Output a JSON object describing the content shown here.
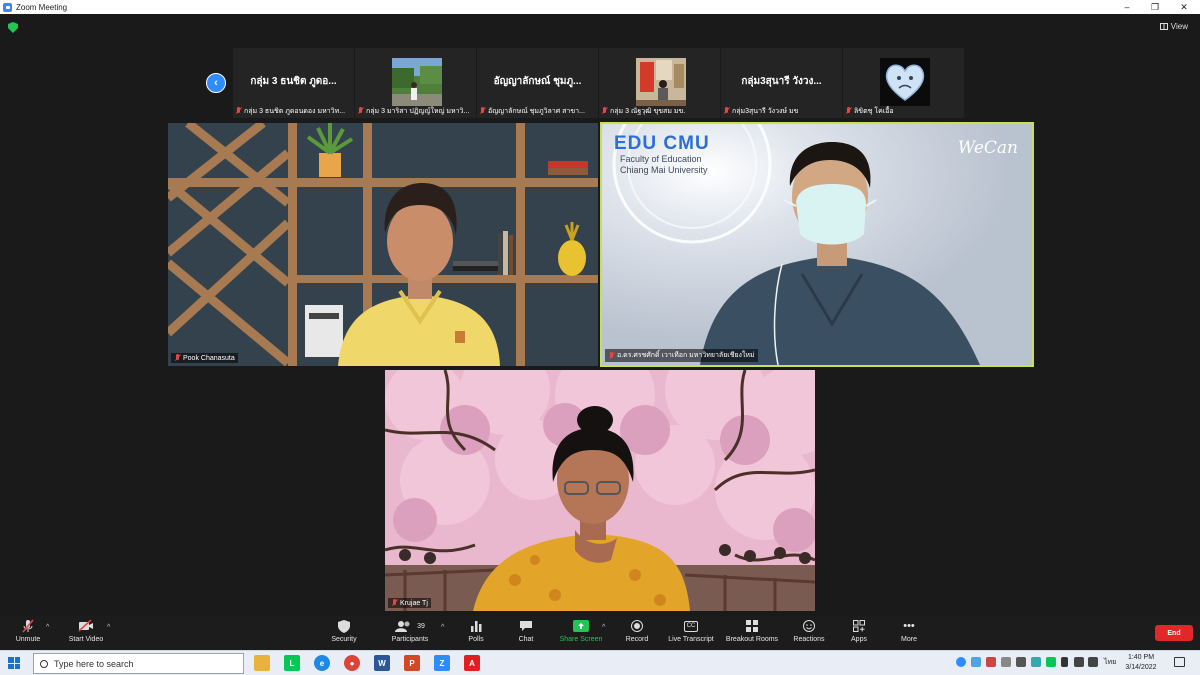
{
  "window": {
    "title": "Zoom Meeting",
    "controls": [
      "–",
      "❐",
      "✕"
    ]
  },
  "meeting": {
    "view_label": "View",
    "thumbnail_strip": [
      {
        "display_name": "กลุ่ม 3 ธนชิต ภูดอ...",
        "footer": "กลุ่ม 3 ธนชิต ภูดอนดอง มหาวิท...",
        "has_video": false
      },
      {
        "display_name": "",
        "footer": "กลุ่ม 3 มาริสา ปฏิญญ์ใหญ่ มหาวิ...",
        "has_video": true
      },
      {
        "display_name": "อัญญาลักษณ์ ชุมภู...",
        "footer": "อัญญาลักษณ์ ชุมภูวิลาศ สาขา...",
        "has_video": false
      },
      {
        "display_name": "",
        "footer": "กลุ่ม 3 ณัฐวุฒิ ขุขสม มข.",
        "has_video": true
      },
      {
        "display_name": "กลุ่ม3สุนารี วังวง...",
        "footer": "กลุ่ม3สุนารี วังวงษ์ มข",
        "has_video": false
      },
      {
        "display_name": "",
        "footer": "ลิขิตชุ โคเอื้อ",
        "has_video": true
      }
    ],
    "video_tiles": [
      {
        "name": "Pook Chanasuta"
      },
      {
        "name": "อ.ดร.ศรชศักดิ์ เวาเทือก มหาวิทยาลัยเชียงใหม่",
        "logo_main": "EDU CMU",
        "logo_sub1": "Faculty of Education",
        "logo_sub2": "Chiang Mai University",
        "brand": "WeCan"
      },
      {
        "name": "Krujae Tj"
      }
    ]
  },
  "toolbar": {
    "unmute": "Unmute",
    "start_video": "Start Video",
    "security": "Security",
    "participants": "Participants",
    "participants_count": "39",
    "polls": "Polls",
    "chat": "Chat",
    "share_screen": "Share Screen",
    "record": "Record",
    "live_transcript": "Live Transcript",
    "breakout_rooms": "Breakout Rooms",
    "reactions": "Reactions",
    "apps": "Apps",
    "more": "More",
    "end": "End"
  },
  "taskbar": {
    "search_placeholder": "Type here to search",
    "language": "ไทย",
    "time": "1:40 PM",
    "date": "3/14/2022"
  },
  "colors": {
    "zoom_blue": "#2d8cff",
    "end_red": "#e02828",
    "share_green": "#23c552",
    "active_speaker": "#c6e05a"
  }
}
